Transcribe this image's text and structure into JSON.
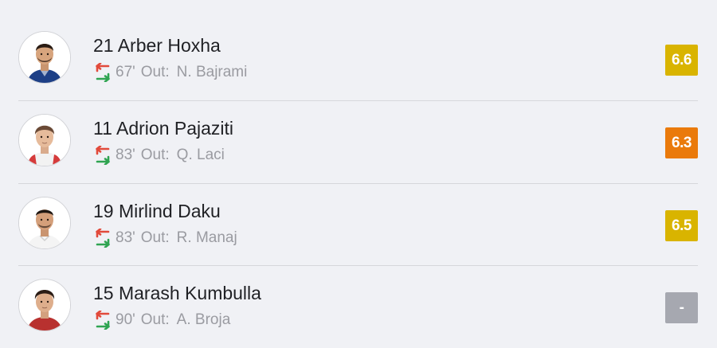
{
  "colors": {
    "background": "#f0f1f5",
    "divider": "#d6d7db",
    "name_text": "#1f2024",
    "sub_text": "#9a9ba1",
    "sub_out_arrow": "#e24a3b",
    "sub_in_arrow": "#2fa451",
    "rating_yellow": "#d9b400",
    "rating_orange": "#ea7a0b",
    "rating_none": "#a6a8b0"
  },
  "players": [
    {
      "name": "21 Arber Hoxha",
      "minute": "67'",
      "out_label": "Out:",
      "out_player": "N. Bajrami",
      "rating": "6.6",
      "rating_color": "#d9b400",
      "substitution_icon": "substitution-arrows-icon"
    },
    {
      "name": "11 Adrion Pajaziti",
      "minute": "83'",
      "out_label": "Out:",
      "out_player": "Q. Laci",
      "rating": "6.3",
      "rating_color": "#ea7a0b",
      "substitution_icon": "substitution-arrows-icon"
    },
    {
      "name": "19 Mirlind Daku",
      "minute": "83'",
      "out_label": "Out:",
      "out_player": "R. Manaj",
      "rating": "6.5",
      "rating_color": "#d9b400",
      "substitution_icon": "substitution-arrows-icon"
    },
    {
      "name": "15 Marash Kumbulla",
      "minute": "90'",
      "out_label": "Out:",
      "out_player": "A. Broja",
      "rating": "-",
      "rating_color": "#a6a8b0",
      "substitution_icon": "substitution-arrows-icon"
    }
  ]
}
